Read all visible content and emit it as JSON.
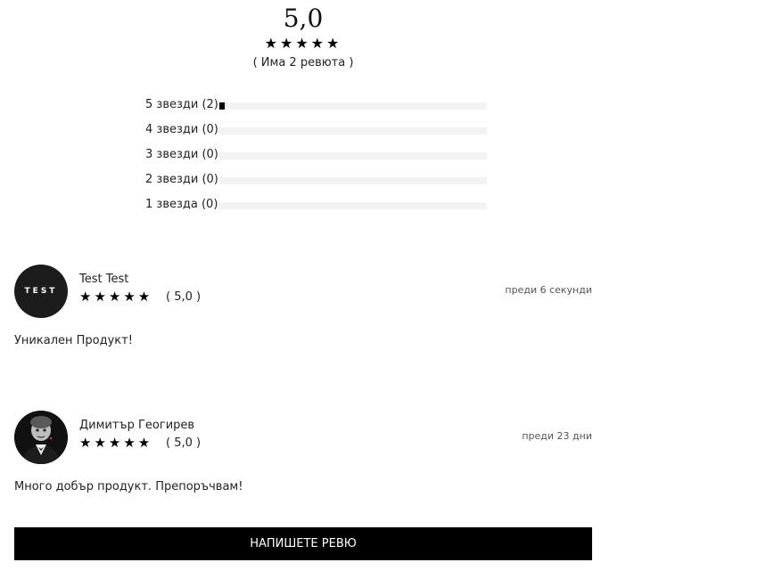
{
  "summary": {
    "score": "5,0",
    "stars": "★★★★★",
    "count_text": "(  Има 2 ревюта )"
  },
  "breakdown": [
    {
      "label": "5 звезди (2)",
      "fraction": 0.02
    },
    {
      "label": "4 звезди (0)",
      "fraction": 0
    },
    {
      "label": "3 звезди (0)",
      "fraction": 0
    },
    {
      "label": "2 звезди (0)",
      "fraction": 0
    },
    {
      "label": "1 звезда (0)",
      "fraction": 0
    }
  ],
  "reviews": [
    {
      "avatar_text": "TEST",
      "name": "Test Test",
      "stars": "★★★★★",
      "score": "( 5,0 )",
      "date": "преди 6 секунди",
      "text": "Уникален  Продукт!"
    },
    {
      "avatar_icon": "man-in-suit-icon",
      "name": "Димитър  Геогирев",
      "stars": "★★★★★",
      "score": "( 5,0 )",
      "date": "преди 23 дни",
      "text": "Много добър продукт.  Препоръчвам!"
    }
  ],
  "button": {
    "label": "НАПИШЕТЕ РЕВЮ"
  }
}
